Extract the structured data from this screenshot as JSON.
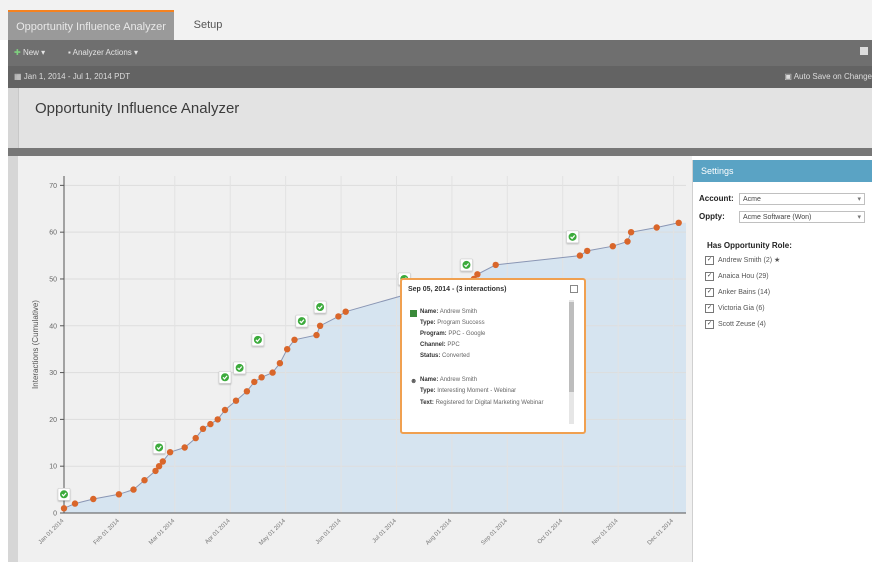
{
  "tabs": {
    "active": "Opportunity Influence Analyzer",
    "setup": "Setup"
  },
  "toolbar": {
    "new_label": "New ▾",
    "actions_label": "Analyzer Actions ▾"
  },
  "subbar": {
    "date_range": "Jan 1, 2014 - Jul 1, 2014 PDT",
    "auto_save": "Auto Save on Change"
  },
  "page": {
    "title": "Opportunity Influence Analyzer"
  },
  "chart_data": {
    "type": "scatter",
    "ylabel": "Interactions (Cumulative)",
    "ylim": [
      0,
      72
    ],
    "yticks": [
      0,
      10,
      20,
      30,
      40,
      50,
      60,
      70
    ],
    "xticks": [
      "Jan 01 2014",
      "Feb 01 2014",
      "Mar 01 2014",
      "Apr 01 2014",
      "May 01 2014",
      "Jun 01 2014",
      "Jul 01 2014",
      "Aug 01 2014",
      "Sep 01 2014",
      "Oct 01 2014",
      "Nov 01 2014",
      "Dec 01 2014"
    ],
    "points": [
      [
        0,
        1
      ],
      [
        0.3,
        2
      ],
      [
        0.8,
        3
      ],
      [
        1.5,
        4
      ],
      [
        1.9,
        5
      ],
      [
        2.2,
        7
      ],
      [
        2.5,
        9
      ],
      [
        2.6,
        10
      ],
      [
        2.7,
        11
      ],
      [
        2.9,
        13
      ],
      [
        3.3,
        14
      ],
      [
        3.6,
        16
      ],
      [
        3.8,
        18
      ],
      [
        4.0,
        19
      ],
      [
        4.2,
        20
      ],
      [
        4.4,
        22
      ],
      [
        4.7,
        24
      ],
      [
        5.0,
        26
      ],
      [
        5.2,
        28
      ],
      [
        5.4,
        29
      ],
      [
        5.7,
        30
      ],
      [
        5.9,
        32
      ],
      [
        6.1,
        35
      ],
      [
        6.3,
        37
      ],
      [
        6.9,
        38
      ],
      [
        7.0,
        40
      ],
      [
        7.5,
        42
      ],
      [
        7.7,
        43
      ],
      [
        9.5,
        47
      ],
      [
        10.2,
        48
      ],
      [
        11.2,
        50
      ],
      [
        11.3,
        51
      ],
      [
        11.8,
        53
      ],
      [
        14.1,
        55
      ],
      [
        14.3,
        56
      ],
      [
        15.0,
        57
      ],
      [
        15.4,
        58
      ],
      [
        15.5,
        60
      ],
      [
        16.2,
        61
      ],
      [
        16.8,
        62
      ]
    ],
    "markers": [
      [
        0,
        4
      ],
      [
        2.6,
        14
      ],
      [
        4.4,
        29
      ],
      [
        4.8,
        31
      ],
      [
        5.3,
        37
      ],
      [
        6.5,
        41
      ],
      [
        7.0,
        44
      ],
      [
        9.3,
        50
      ],
      [
        11.0,
        53
      ],
      [
        13.9,
        59
      ]
    ]
  },
  "settings": {
    "header": "Settings",
    "account_label": "Account:",
    "account_value": "Acme",
    "oppty_label": "Oppty:",
    "oppty_value": "Acme Software (Won)",
    "roles_label": "Has Opportunity Role:",
    "roles": [
      "Andrew Smith (2) ★",
      "Anaica Hou (29)",
      "Anker Bains (14)",
      "Victoria Gia (6)",
      "Scott Zeuse (4)"
    ]
  },
  "tooltip": {
    "title": "Sep 05, 2014 - (3 interactions)",
    "entry1": {
      "name": "Andrew Smith",
      "type": "Program Success",
      "program": "PPC - Google",
      "channel": "PPC",
      "status": "Converted"
    },
    "entry2": {
      "name": "Andrew Smith",
      "type": "Interesting Moment - Webinar",
      "text": "Registered for Digital Marketing Webinar"
    }
  }
}
